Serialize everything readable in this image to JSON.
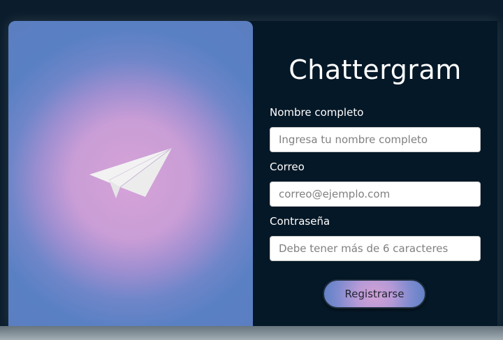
{
  "app": {
    "title": "Chattergram"
  },
  "form": {
    "name_label": "Nombre completo",
    "name_placeholder": "Ingresa tu nombre completo",
    "name_value": "",
    "email_label": "Correo",
    "email_placeholder": "correo@ejemplo.com",
    "email_value": "",
    "password_label": "Contraseña",
    "password_placeholder": "Debe tener más de 6 caracteres",
    "password_value": "",
    "submit_label": "Registrarse"
  },
  "icons": {
    "hero": "paper-plane-icon"
  },
  "colors": {
    "background": "#051827",
    "gradient_center": "#d5a3d8",
    "gradient_edge": "#5b7ec0",
    "text": "#ffffff"
  }
}
